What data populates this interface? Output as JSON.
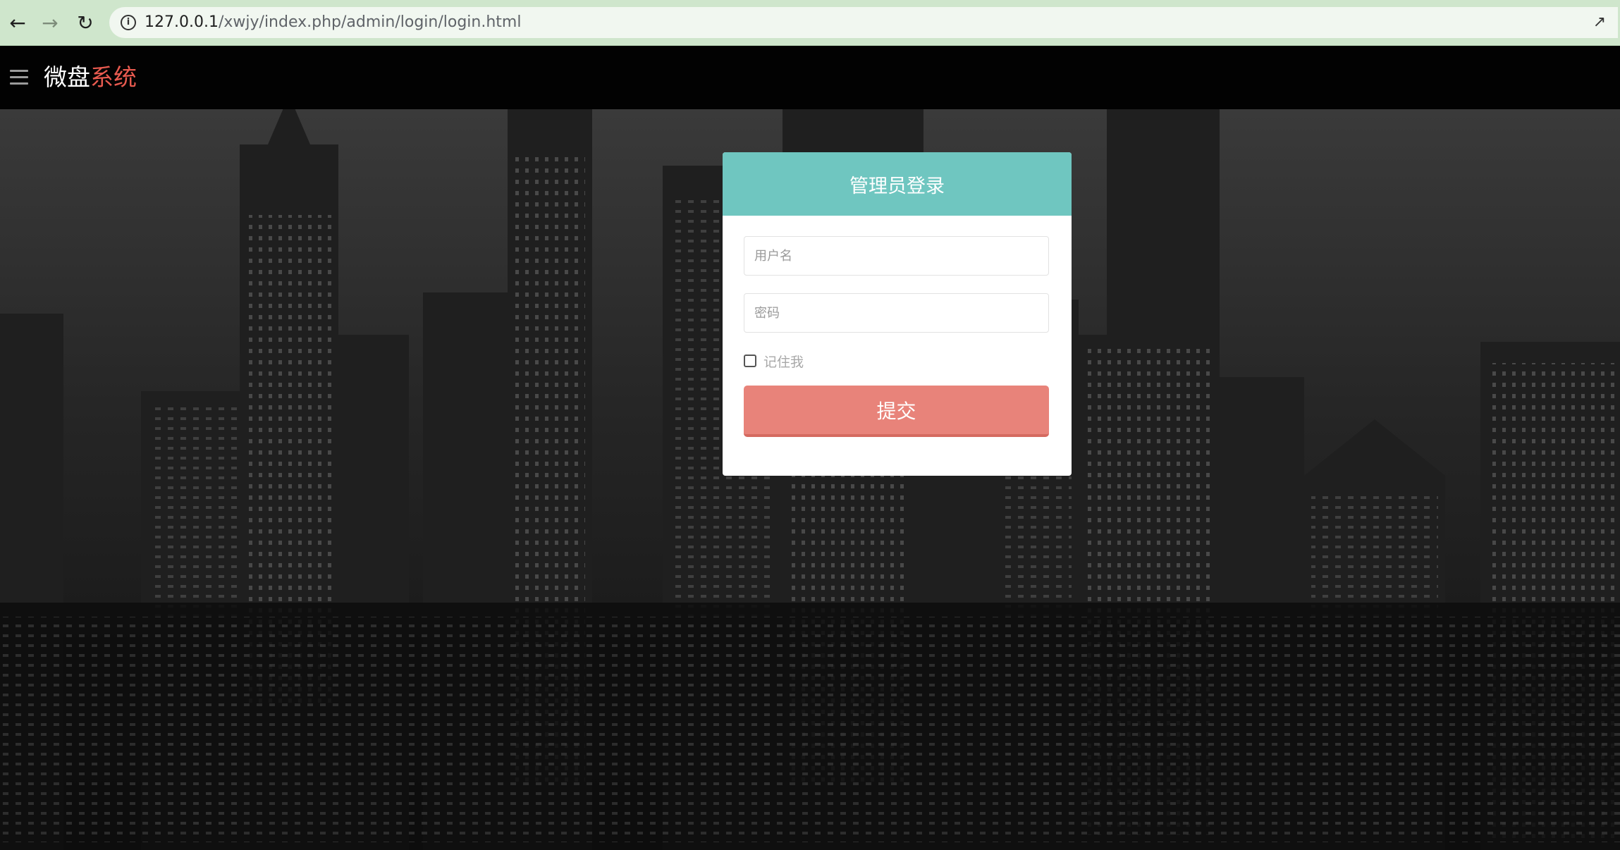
{
  "browser": {
    "back_icon": "arrow-left-icon",
    "forward_icon": "arrow-right-icon",
    "reload_icon": "reload-icon",
    "url_host": "127.0.0.1",
    "url_path": "/xwjy/index.php/admin/login/login.html"
  },
  "header": {
    "menu_icon": "hamburger-menu-icon",
    "brand_main": "微盘",
    "brand_accent": "系统"
  },
  "login": {
    "title": "管理员登录",
    "username_placeholder": "用户名",
    "password_placeholder": "密码",
    "remember_label": "记住我",
    "submit_label": "提交"
  },
  "colors": {
    "panel_header": "#6fc6c0",
    "submit_button": "#e8837a",
    "brand_accent": "#e85a4f"
  }
}
